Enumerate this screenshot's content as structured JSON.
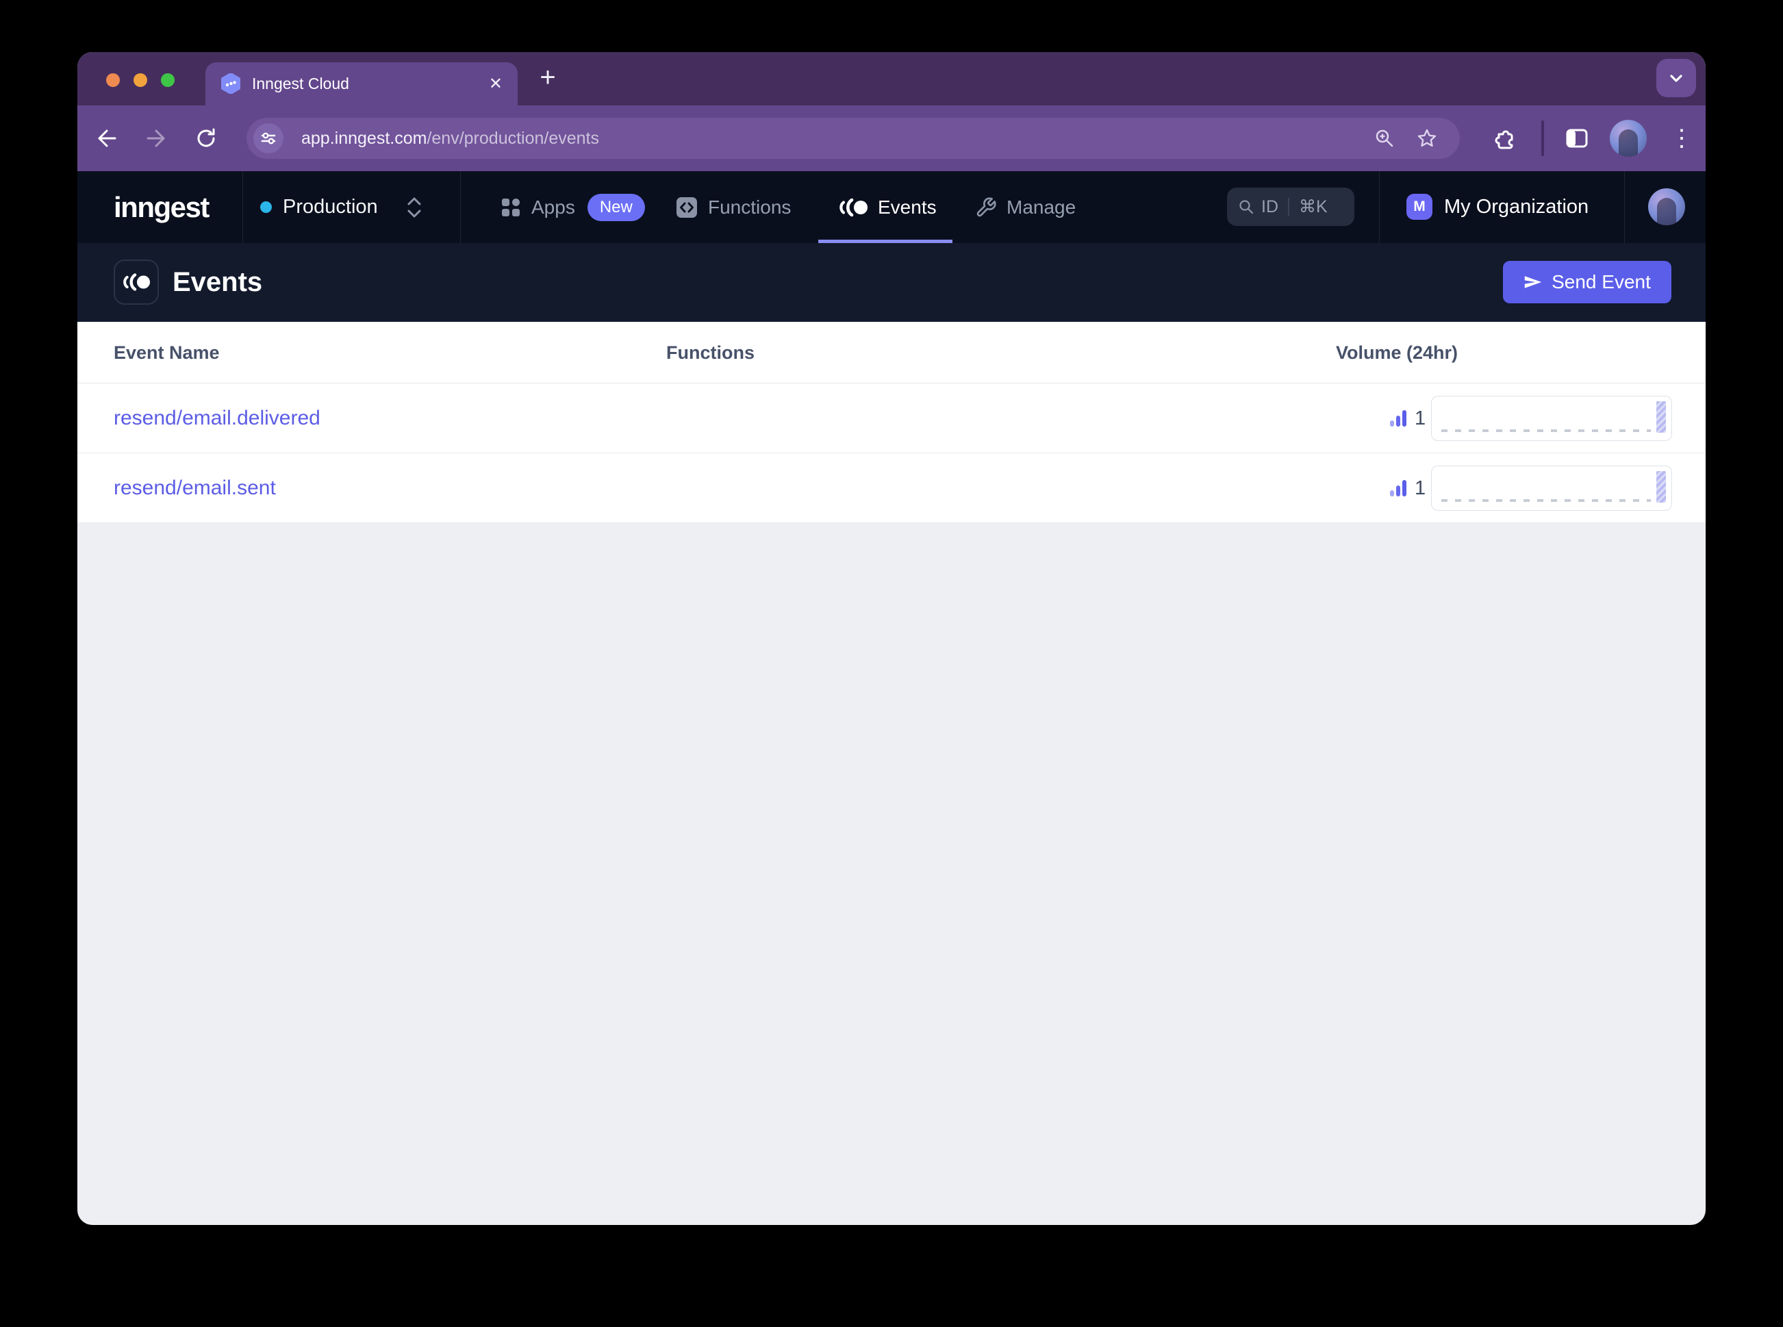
{
  "browser": {
    "tab_title": "Inngest Cloud",
    "close_glyph": "✕",
    "new_tab_glyph": "+",
    "menu_glyph": "⋮",
    "url_host": "app.inngest.com",
    "url_path": "/env/production/events"
  },
  "header": {
    "logo": "inngest",
    "environment": "Production",
    "nav": {
      "apps": "Apps",
      "apps_badge": "New",
      "functions": "Functions",
      "events": "Events",
      "manage": "Manage"
    },
    "search_id": "ID",
    "search_shortcut": "⌘K",
    "org_initial": "M",
    "org_name": "My Organization"
  },
  "page": {
    "title": "Events",
    "send_event": "Send Event"
  },
  "table": {
    "col_event_name": "Event Name",
    "col_functions": "Functions",
    "col_volume": "Volume (24hr)",
    "rows": [
      {
        "name": "resend/email.delivered",
        "functions": "",
        "volume": "1"
      },
      {
        "name": "resend/email.sent",
        "functions": "",
        "volume": "1"
      }
    ]
  },
  "colors": {
    "accent_indigo": "#5b5ee9",
    "link": "#5c5ce6",
    "env_dot": "#2bb5e8",
    "badge_new": "#6a6ff5"
  }
}
